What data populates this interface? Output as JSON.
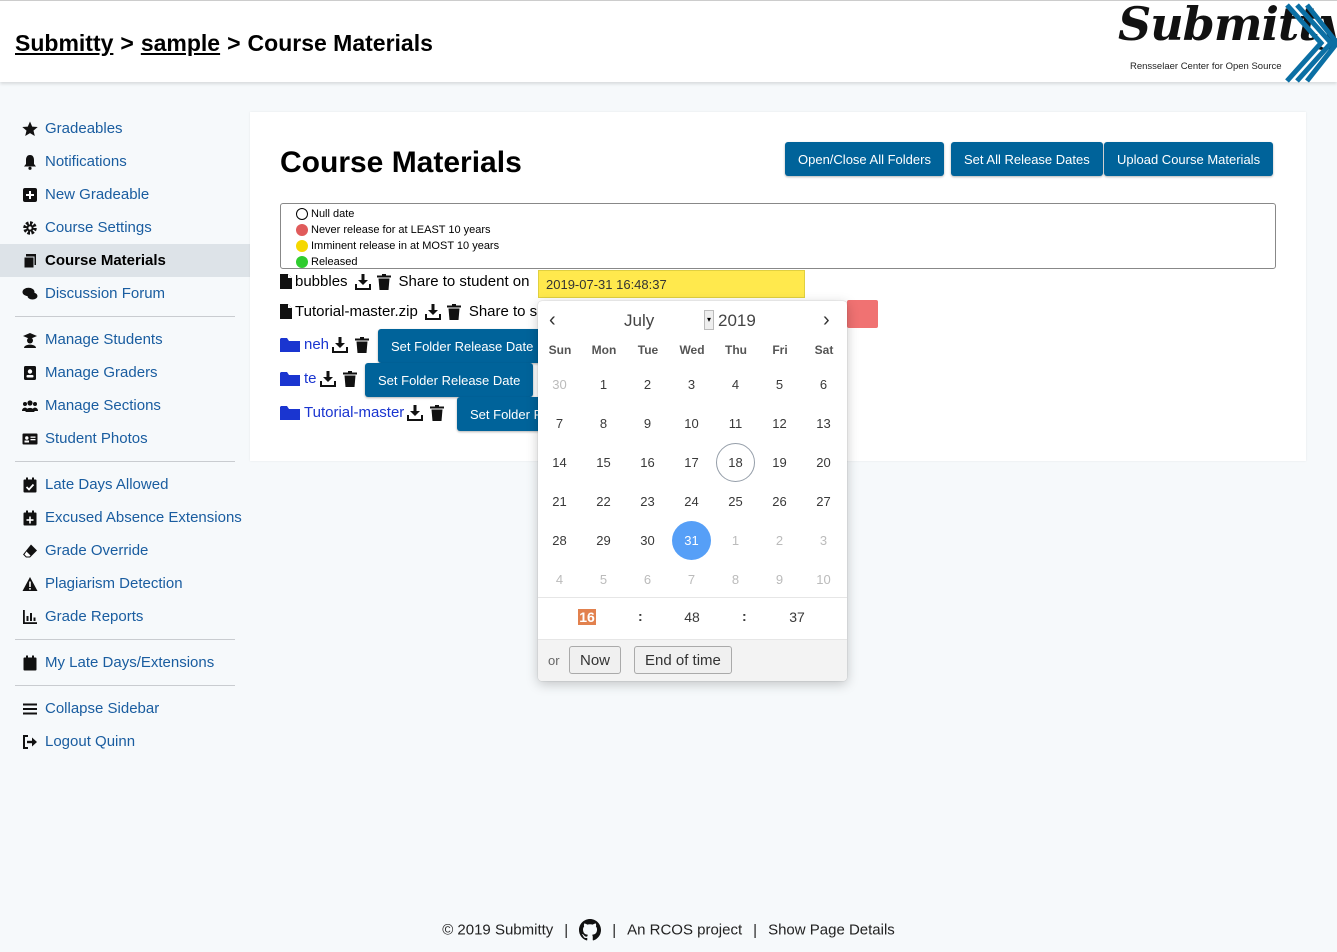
{
  "breadcrumb": {
    "home": "Submitty",
    "sep1": ">",
    "course": "sample",
    "sep2": ">",
    "current": "Course Materials"
  },
  "logo": {
    "word": "Submitty",
    "subtitle": "Rensselaer Center for Open Source",
    "icon": "submitty-chevrons-logo"
  },
  "sidebar": {
    "items": [
      {
        "label": "Gradeables",
        "icon": "star-icon"
      },
      {
        "label": "Notifications",
        "icon": "bell-icon"
      },
      {
        "label": "New Gradeable",
        "icon": "plus-square-icon"
      },
      {
        "label": "Course Settings",
        "icon": "gear-icon"
      },
      {
        "label": "Course Materials",
        "icon": "copy-icon",
        "active": true
      },
      {
        "label": "Discussion Forum",
        "icon": "comments-icon"
      },
      {
        "label": "Manage Students",
        "icon": "graduate-icon"
      },
      {
        "label": "Manage Graders",
        "icon": "id-badge-icon"
      },
      {
        "label": "Manage Sections",
        "icon": "users-icon"
      },
      {
        "label": "Student Photos",
        "icon": "id-card-icon"
      },
      {
        "label": "Late Days Allowed",
        "icon": "calendar-check-icon"
      },
      {
        "label": "Excused Absence Extensions",
        "icon": "calendar-plus-icon"
      },
      {
        "label": "Grade Override",
        "icon": "eraser-icon"
      },
      {
        "label": "Plagiarism Detection",
        "icon": "warning-icon"
      },
      {
        "label": "Grade Reports",
        "icon": "chart-icon"
      },
      {
        "label": "My Late Days/Extensions",
        "icon": "calendar-icon"
      },
      {
        "label": "Collapse Sidebar",
        "icon": "bars-icon"
      },
      {
        "label": "Logout Quinn",
        "icon": "sign-out-icon"
      }
    ]
  },
  "main": {
    "title": "Course Materials",
    "buttons": {
      "toggle_folders": "Open/Close All Folders",
      "set_all_dates": "Set All Release Dates",
      "upload": "Upload Course Materials"
    },
    "legend": [
      {
        "label": "Null date",
        "color": "#ffffff"
      },
      {
        "label": "Never release for at LEAST 10 years",
        "color": "#e05b5b"
      },
      {
        "label": "Imminent release in at MOST 10 years",
        "color": "#f5d800"
      },
      {
        "label": "Released",
        "color": "#2fcc2f"
      }
    ],
    "files": [
      {
        "name": "bubbles",
        "share_label": "Share to student on",
        "date": "2019-07-31 16:48:37"
      },
      {
        "name": "Tutorial-master.zip",
        "share_label": "Share to s"
      }
    ],
    "folders": [
      {
        "name": "neh",
        "button": "Set Folder Release Date"
      },
      {
        "name": "te",
        "button": "Set Folder Release Date"
      },
      {
        "name": "Tutorial-master",
        "button": "Set Folder R"
      }
    ]
  },
  "calendar": {
    "month": "July",
    "year": "2019",
    "weekdays": [
      "Sun",
      "Mon",
      "Tue",
      "Wed",
      "Thu",
      "Fri",
      "Sat"
    ],
    "weeks": [
      [
        "30",
        "1",
        "2",
        "3",
        "4",
        "5",
        "6"
      ],
      [
        "7",
        "8",
        "9",
        "10",
        "11",
        "12",
        "13"
      ],
      [
        "14",
        "15",
        "16",
        "17",
        "18",
        "19",
        "20"
      ],
      [
        "21",
        "22",
        "23",
        "24",
        "25",
        "26",
        "27"
      ],
      [
        "28",
        "29",
        "30",
        "31",
        "1",
        "2",
        "3"
      ],
      [
        "4",
        "5",
        "6",
        "7",
        "8",
        "9",
        "10"
      ]
    ],
    "today": "18",
    "selected": "31",
    "time": {
      "hour": "16",
      "minute": "48",
      "second": "37",
      "sep": ":"
    },
    "footer": {
      "or": "or",
      "now": "Now",
      "end": "End of time"
    }
  },
  "footer": {
    "copyright": "© 2019 Submitty",
    "sep": "|",
    "rcos": "An RCOS project",
    "details": "Show Page Details",
    "github_icon": "github-icon"
  }
}
